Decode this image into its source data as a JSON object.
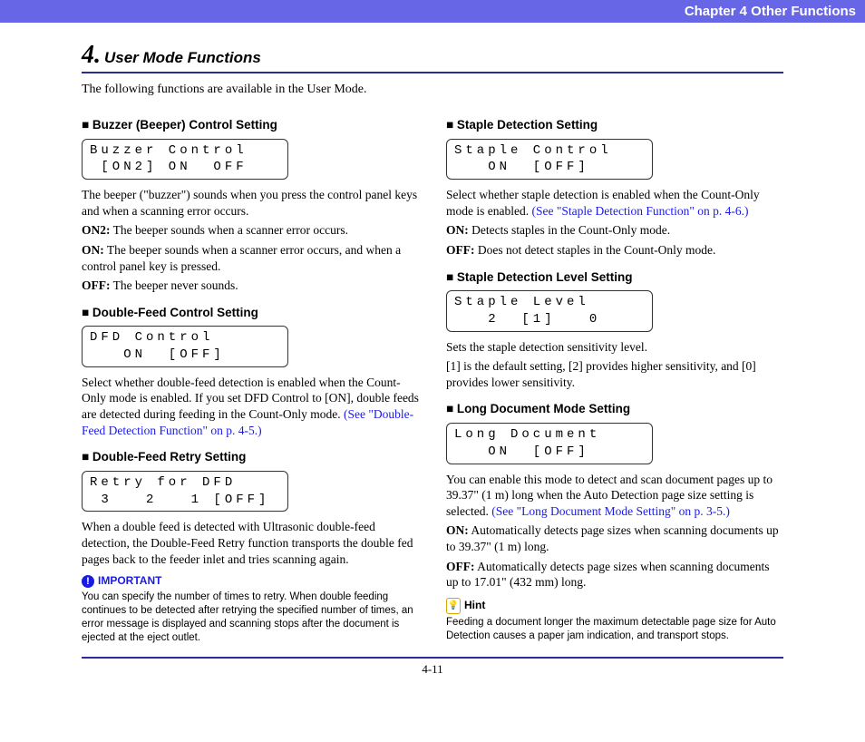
{
  "header": {
    "chapter": "Chapter 4   Other Functions"
  },
  "section": {
    "number": "4.",
    "title": "User Mode Functions",
    "intro": "The following functions are available in the User Mode."
  },
  "left": {
    "buzzer": {
      "heading": "Buzzer (Beeper) Control Setting",
      "lcd_l1": "Buzzer Control",
      "lcd_l2": " [ON2] ON  OFF",
      "p1": "The beeper (\"buzzer\") sounds when you press the control panel keys and when a scanning error occurs.",
      "on2_label": "ON2:",
      "on2_text": " The beeper sounds when a scanner error occurs.",
      "on_label": "ON:",
      "on_text": " The beeper sounds when a scanner error occurs, and when a control panel key is pressed.",
      "off_label": "OFF:",
      "off_text": " The beeper never sounds."
    },
    "dfd": {
      "heading": "Double-Feed Control Setting",
      "lcd_l1": "DFD Control",
      "lcd_l2": "   ON  [OFF]",
      "p1": "Select whether double-feed detection is enabled when the Count-Only mode is enabled. If you set DFD Control to [ON], double feeds are detected during feeding in the Count-Only mode. ",
      "link": "(See \"Double-Feed Detection Function\" on p. 4-5.)"
    },
    "retry": {
      "heading": "Double-Feed Retry Setting",
      "lcd_l1": "Retry for DFD",
      "lcd_l2": " 3   2   1 [OFF]",
      "p1": "When a double feed is detected with Ultrasonic double-feed detection, the Double-Feed Retry function transports the double fed pages back to the feeder inlet and tries scanning again.",
      "important_label": "IMPORTANT",
      "important_text": "You can specify the number of times to retry. When double feeding continues to be detected after retrying the specified number of times, an error message is displayed and scanning stops after the document is ejected at the eject outlet."
    }
  },
  "right": {
    "staple_detect": {
      "heading": "Staple Detection Setting",
      "lcd_l1": "Staple Control",
      "lcd_l2": "   ON  [OFF]",
      "p1": "Select whether staple detection is enabled when the Count-Only mode is enabled. ",
      "link": "(See \"Staple Detection Function\" on p. 4-6.)",
      "on_label": "ON:",
      "on_text": " Detects staples in the Count-Only mode.",
      "off_label": "OFF:",
      "off_text": " Does not detect staples in the Count-Only mode."
    },
    "staple_level": {
      "heading": "Staple Detection Level Setting",
      "lcd_l1": "Staple Level",
      "lcd_l2": "   2  [1]   0",
      "p1": "Sets the staple detection sensitivity level.",
      "p2": "[1] is the default setting, [2] provides higher sensitivity, and [0] provides lower sensitivity."
    },
    "long_doc": {
      "heading": "Long Document Mode Setting",
      "lcd_l1": "Long Document",
      "lcd_l2": "   ON  [OFF]",
      "p1": "You can enable this mode to detect and scan document pages up to 39.37\" (1 m) long when the Auto Detection page size setting is selected. ",
      "link": "(See \"Long Document Mode Setting\" on p. 3-5.)",
      "on_label": "ON:",
      "on_text": " Automatically detects page sizes when scanning documents up to 39.37\" (1 m) long.",
      "off_label": "OFF:",
      "off_text": " Automatically detects page sizes when scanning documents up to 17.01\" (432 mm) long.",
      "hint_label": "Hint",
      "hint_text": "Feeding a document longer the maximum detectable page size for Auto Detection causes a paper jam indication, and transport stops."
    }
  },
  "footer": {
    "page": "4-11"
  }
}
